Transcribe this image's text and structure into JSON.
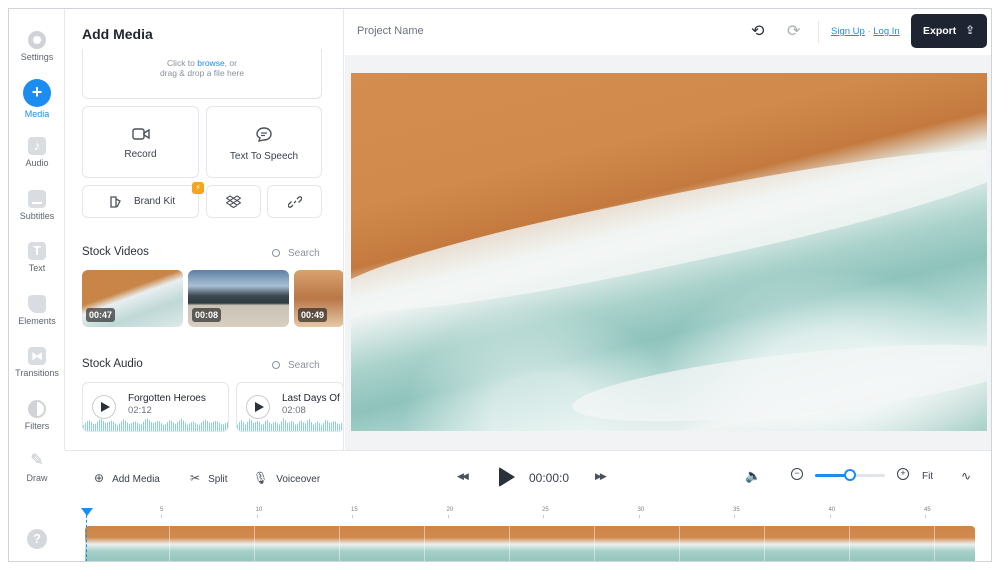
{
  "sidebar": {
    "items": [
      {
        "label": "Settings",
        "icon": "gear-icon"
      },
      {
        "label": "Media",
        "icon": "plus-icon",
        "active": true
      },
      {
        "label": "Audio",
        "icon": "music-note-icon"
      },
      {
        "label": "Subtitles",
        "icon": "subtitles-icon"
      },
      {
        "label": "Text",
        "icon": "text-icon"
      },
      {
        "label": "Elements",
        "icon": "shapes-icon"
      },
      {
        "label": "Transitions",
        "icon": "transitions-icon"
      },
      {
        "label": "Filters",
        "icon": "filter-icon"
      },
      {
        "label": "Draw",
        "icon": "pencil-icon"
      }
    ],
    "help": "?"
  },
  "panel": {
    "title": "Add Media",
    "drop_prefix": "Click to ",
    "drop_link": "browse",
    "drop_suffix": ", or",
    "drop_line2": "drag & drop a file here",
    "record_label": "Record",
    "tts_label": "Text To Speech",
    "brand_kit_label": "Brand Kit",
    "brand_kit_badge": "⚡",
    "stock_videos_title": "Stock Videos",
    "stock_audio_title": "Stock Audio",
    "search_label": "Search",
    "videos": [
      {
        "duration": "00:47"
      },
      {
        "duration": "00:08"
      },
      {
        "duration": "00:49"
      }
    ],
    "audio": [
      {
        "name": "Forgotten Heroes",
        "duration": "02:12"
      },
      {
        "name": "Last Days Of",
        "duration": "02:08"
      }
    ]
  },
  "topbar": {
    "project_name": "Project Name",
    "sign_up": "Sign Up",
    "separator": " · ",
    "log_in": "Log In",
    "export_label": "Export"
  },
  "toolbar": {
    "add_media": "Add Media",
    "split": "Split",
    "voiceover": "Voiceover",
    "timecode": "00:00:0",
    "fit": "Fit",
    "zoom_level": 0.5
  },
  "timeline": {
    "ticks": [
      "5",
      "10",
      "15",
      "20",
      "25",
      "30",
      "35",
      "40",
      "45"
    ]
  },
  "colors": {
    "accent": "#1c8cf0",
    "export_bg": "#1e2431",
    "badge": "#f4a51c"
  }
}
